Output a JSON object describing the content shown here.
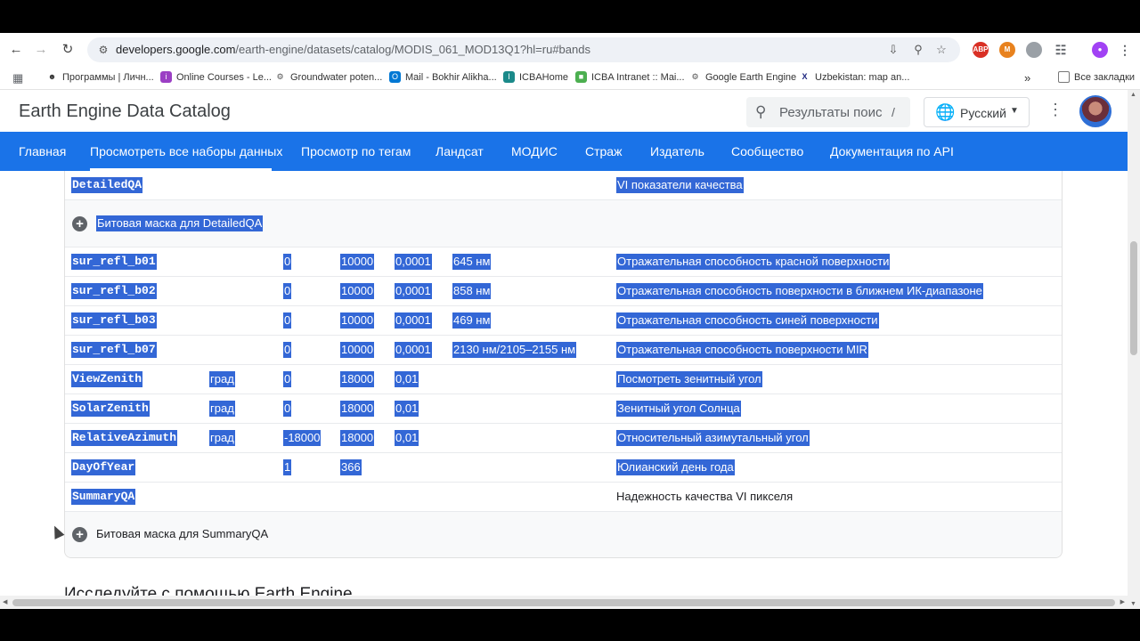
{
  "browser": {
    "url_host": "developers.google.com",
    "url_path": "/earth-engine/datasets/catalog/MODIS_061_MOD13Q1?hl=ru#bands",
    "icons": [
      "back-icon",
      "forward-icon",
      "reload-icon",
      "site-info-icon",
      "install-icon",
      "zoom-icon",
      "star-icon"
    ],
    "extensions": [
      {
        "label": "ABP",
        "color": "#d93025"
      },
      {
        "label": "M",
        "color": "#e8821e"
      },
      {
        "label": "",
        "color": "#9aa0a6"
      },
      {
        "label": "",
        "color": "#5f6368"
      },
      {
        "label": "",
        "color": "#5f6368"
      }
    ]
  },
  "bookmarks": {
    "items": [
      {
        "label": "Программы | Личн..."
      },
      {
        "label": "Online Courses - Le..."
      },
      {
        "label": "Groundwater poten..."
      },
      {
        "label": "Mail - Bokhir Alikha..."
      },
      {
        "label": "ICBAHome"
      },
      {
        "label": "ICBA Intranet :: Mai..."
      },
      {
        "label": "Google Earth Engine"
      },
      {
        "label": "Uzbekistan: map an..."
      }
    ],
    "overflow": "»",
    "all_bookmarks": "Все закладки"
  },
  "header": {
    "title": "Earth Engine Data Catalog",
    "search_placeholder": "Результаты поис",
    "search_shortcut": "/",
    "language": "Русский"
  },
  "nav": {
    "tabs": [
      {
        "label": "Главная"
      },
      {
        "label": "Просмотреть все наборы данных"
      },
      {
        "label": "Просмотр по тегам"
      },
      {
        "label": "Ландсат"
      },
      {
        "label": "МОДИС"
      },
      {
        "label": "Страж"
      },
      {
        "label": "Издатель"
      },
      {
        "label": "Сообщество"
      },
      {
        "label": "Документация по API"
      }
    ],
    "active_tab": "Просмотреть все наборы данных"
  },
  "bands": {
    "rows": [
      {
        "name": "DetailedQA",
        "units": "",
        "min": "",
        "max": "",
        "scale": "",
        "wavelength": "",
        "description": "VI показатели качества",
        "selected": true
      },
      {
        "name": "sur_refl_b01",
        "units": "",
        "min": "0",
        "max": "10000",
        "scale": "0,0001",
        "wavelength": "645 нм",
        "description": "Отражательная способность красной поверхности",
        "selected": true
      },
      {
        "name": "sur_refl_b02",
        "units": "",
        "min": "0",
        "max": "10000",
        "scale": "0,0001",
        "wavelength": "858 нм",
        "description": "Отражательная способность поверхности в ближнем ИК-диапазоне",
        "selected": true
      },
      {
        "name": "sur_refl_b03",
        "units": "",
        "min": "0",
        "max": "10000",
        "scale": "0,0001",
        "wavelength": "469 нм",
        "description": "Отражательная способность синей поверхности",
        "selected": true
      },
      {
        "name": "sur_refl_b07",
        "units": "",
        "min": "0",
        "max": "10000",
        "scale": "0,0001",
        "wavelength": "2130 нм/2105–2155 нм",
        "description": "Отражательная способность поверхности MIR",
        "selected": true
      },
      {
        "name": "ViewZenith",
        "units": "град",
        "min": "0",
        "max": "18000",
        "scale": "0,01",
        "wavelength": "",
        "description": "Посмотреть зенитный угол",
        "selected": true
      },
      {
        "name": "SolarZenith",
        "units": "град",
        "min": "0",
        "max": "18000",
        "scale": "0,01",
        "wavelength": "",
        "description": "Зенитный угол Солнца",
        "selected": true
      },
      {
        "name": "RelativeAzimuth",
        "units": "град",
        "min": "-18000",
        "max": "18000",
        "scale": "0,01",
        "wavelength": "",
        "description": "Относительный азимутальный угол",
        "selected": true
      },
      {
        "name": "DayOfYear",
        "units": "",
        "min": "1",
        "max": "366",
        "scale": "",
        "wavelength": "",
        "description": "Юлианский день года",
        "selected": true
      },
      {
        "name": "SummaryQA",
        "units": "",
        "min": "",
        "max": "",
        "scale": "",
        "wavelength": "",
        "description": "Надежность качества VI пикселя",
        "selected": false
      }
    ],
    "bitmask_detailed": "Битовая маска для DetailedQA",
    "bitmask_summary": "Битовая маска для SummaryQA"
  },
  "next_section": "Исследуйте с помощью Earth Engine",
  "colors": {
    "accent": "#1a73e8",
    "selection": "#3367d6"
  }
}
